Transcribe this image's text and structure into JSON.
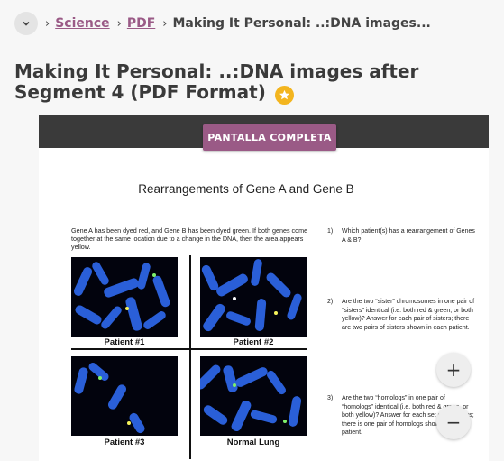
{
  "breadcrumb": {
    "items": [
      {
        "label": "Science"
      },
      {
        "label": "PDF"
      }
    ],
    "current": "Making It Personal: ..:DNA images...",
    "separator": "›"
  },
  "page_title": "Making It Personal: ..:DNA images after Segment 4 (PDF Format)",
  "viewer": {
    "fullscreen_label": "PANTALLA COMPLETA",
    "zoom_in_label": "+",
    "zoom_out_label": "−"
  },
  "document": {
    "title": "Rearrangements of Gene A and Gene B",
    "intro": "Gene A has been dyed red, and Gene B has been dyed green. If both genes come together at the same location due to a change in the DNA, then the area appears yellow.",
    "panels": [
      "Patient #1",
      "Patient #2",
      "Patient #3",
      "Normal Lung"
    ],
    "questions": [
      {
        "num": "1)",
        "text": "Which patient(s) has a rearrangement of Genes A & B?"
      },
      {
        "num": "2)",
        "text": "Are the two “sister” chromosomes in one pair of “sisters” identical (i.e. both red & green, or both yellow)? Answer for each pair of sisters; there are two pairs of sisters shown in each patient."
      },
      {
        "num": "3)",
        "text": "Are the two “homologs” in one pair of “homologs” identical (i.e. both red & green, or both yellow)? Answer for each set of homologs; there is one pair of homologs shown in each patient."
      }
    ]
  },
  "colors": {
    "accent": "#9a5a86",
    "star": "#f3b51f",
    "viewer_bar": "#3a3a3a",
    "chromosome": "#2a5fd8",
    "micro_background": "#02030d"
  },
  "icons": {
    "breadcrumb_toggle": "chevron-down-icon",
    "favorite": "star-icon"
  }
}
